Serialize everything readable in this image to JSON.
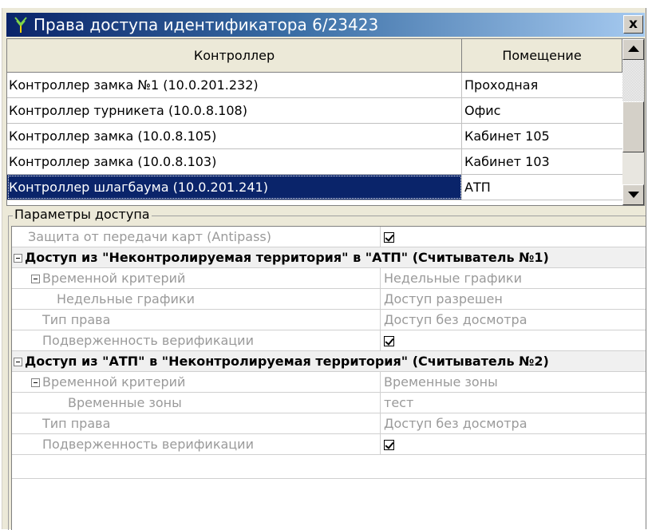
{
  "window": {
    "title": "Права доступа идентификатора 6/23423",
    "close_label": "x"
  },
  "list": {
    "columns": [
      "Контроллер",
      "Помещение"
    ],
    "rows": [
      {
        "controller": "Контроллер замка №1 (10.0.201.232)",
        "room": "Проходная"
      },
      {
        "controller": "Контроллер турникета (10.0.8.108)",
        "room": "Офис"
      },
      {
        "controller": "Контроллер замка (10.0.8.105)",
        "room": "Кабинет 105"
      },
      {
        "controller": "Контроллер замка (10.0.8.103)",
        "room": "Кабинет 103"
      },
      {
        "controller": "Контроллер шлагбаума (10.0.201.241)",
        "room": "АТП",
        "selected": true
      }
    ]
  },
  "params": {
    "group_label": "Параметры доступа",
    "antipass": {
      "label": "Защита от передачи карт (Antipass)",
      "checked": true
    },
    "sections": [
      {
        "title": "Доступ из \"Неконтролируемая территория\" в \"АТП\" (Считыватель №1)",
        "time_criterion": {
          "label": "Временной критерий",
          "value": "Недельные графики"
        },
        "sub": {
          "label": "Недельные графики",
          "value": "Доступ разрешен"
        },
        "right_type": {
          "label": "Тип права",
          "value": "Доступ без досмотра"
        },
        "verification": {
          "label": "Подверженность верификации",
          "checked": true
        }
      },
      {
        "title": "Доступ из \"АТП\" в \"Неконтролируемая территория\" (Считыватель №2)",
        "time_criterion": {
          "label": "Временной критерий",
          "value": "Временные зоны"
        },
        "sub": {
          "label": "Временные зоны",
          "value": "тест"
        },
        "right_type": {
          "label": "Тип права",
          "value": "Доступ без досмотра"
        },
        "verification": {
          "label": "Подверженность верификации",
          "checked": true
        }
      }
    ]
  },
  "colors": {
    "title_start": "#0a246a",
    "title_end": "#a6caf0",
    "selection": "#0a246a"
  },
  "icons": {
    "app": "antenna-icon",
    "close": "close-icon",
    "up": "scroll-up-arrow-icon",
    "down": "scroll-down-arrow-icon",
    "checkbox": "checkbox-checked-icon",
    "collapse": "minus-expander-icon"
  }
}
